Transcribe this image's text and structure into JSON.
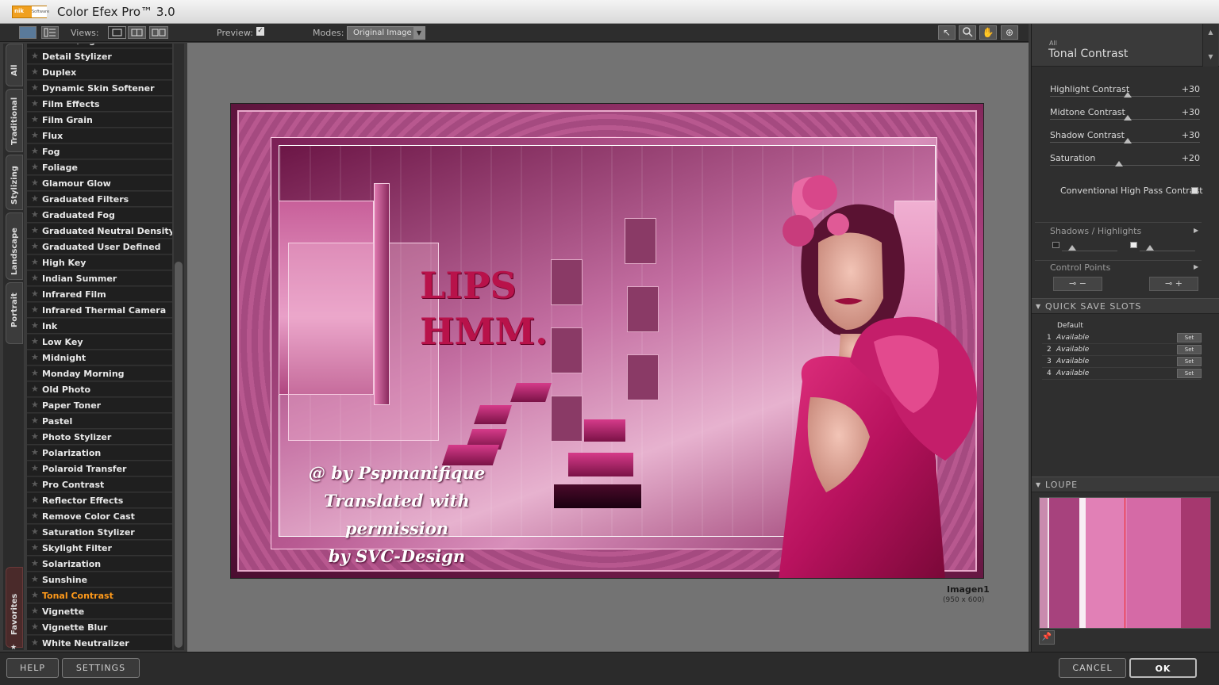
{
  "app": {
    "title": "Color Efex Pro™ 3.0",
    "logo_text": "nik",
    "logo_sub": "Software"
  },
  "toolbar": {
    "views_label": "Views:",
    "preview_label": "Preview:",
    "preview_check": "✓",
    "modes_label": "Modes:",
    "modes_value": "Original Image"
  },
  "side_tabs": [
    "All",
    "Traditional",
    "Stylizing",
    "Landscape",
    "Portrait"
  ],
  "favorites_tab": "Favorites",
  "filters": [
    "Darken/Lighten Center",
    "Detail Stylizer",
    "Duplex",
    "Dynamic Skin Softener",
    "Film Effects",
    "Film Grain",
    "Flux",
    "Fog",
    "Foliage",
    "Glamour Glow",
    "Graduated Filters",
    "Graduated Fog",
    "Graduated Neutral Density",
    "Graduated User Defined",
    "High Key",
    "Indian Summer",
    "Infrared Film",
    "Infrared Thermal Camera",
    "Ink",
    "Low Key",
    "Midnight",
    "Monday Morning",
    "Old Photo",
    "Paper Toner",
    "Pastel",
    "Photo Stylizer",
    "Polarization",
    "Polaroid Transfer",
    "Pro Contrast",
    "Reflector Effects",
    "Remove Color Cast",
    "Saturation Stylizer",
    "Skylight Filter",
    "Solarization",
    "Sunshine",
    "Tonal Contrast",
    "Vignette",
    "Vignette Blur",
    "White Neutralizer"
  ],
  "active_filter_index": 35,
  "image": {
    "lips_line1": "LIPS",
    "lips_line2": "HMM.",
    "credit_line1": "@ by Pspmanifique",
    "credit_line2": "Translated with permission",
    "credit_line3": "by SVC-Design",
    "name": "Imagen1",
    "size": "(950 x 600)"
  },
  "panel": {
    "category": "All",
    "filter_name": "Tonal Contrast",
    "sliders": [
      {
        "label": "Highlight Contrast",
        "value": "+30",
        "level": 0.52
      },
      {
        "label": "Midtone Contrast",
        "value": "+30",
        "level": 0.52
      },
      {
        "label": "Shadow Contrast",
        "value": "+30",
        "level": 0.52
      },
      {
        "label": "Saturation",
        "value": "+20",
        "level": 0.46
      }
    ],
    "conventional_label": "Conventional High Pass Contrast",
    "shadows_highlights": "Shadows / Highlights",
    "control_points": "Control Points"
  },
  "quick_save": {
    "title": "QUICK SAVE SLOTS",
    "default_label": "Default",
    "slots": [
      {
        "num": "1",
        "status": "Available",
        "btn": "Set"
      },
      {
        "num": "2",
        "status": "Available",
        "btn": "Set"
      },
      {
        "num": "3",
        "status": "Available",
        "btn": "Set"
      },
      {
        "num": "4",
        "status": "Available",
        "btn": "Set"
      }
    ]
  },
  "loupe": {
    "title": "LOUPE"
  },
  "bottom": {
    "help": "HELP",
    "settings": "SETTINGS",
    "cancel": "CANCEL",
    "ok": "OK"
  },
  "colors": {
    "active_filter": "#ff9a1a",
    "accent_magenta": "#c2327a"
  }
}
